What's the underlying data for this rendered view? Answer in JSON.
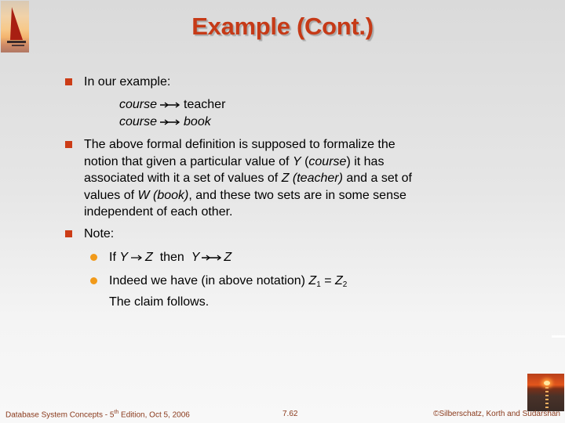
{
  "slide": {
    "title": "Example (Cont.)",
    "bullets": [
      {
        "text": "In our example:",
        "examples": [
          {
            "left": "course",
            "arrow": "multivalued-dependency-arrow",
            "right": "teacher",
            "right_italic": false
          },
          {
            "left": "course",
            "arrow": "multivalued-dependency-arrow",
            "right": "book",
            "right_italic": true
          }
        ]
      },
      {
        "lines": [
          {
            "parts": [
              "The above formal definition is supposed to formalize the"
            ]
          },
          {
            "parts": [
              "notion that given a particular value of ",
              "Y",
              " (",
              "course",
              ") it has"
            ]
          },
          {
            "parts": [
              "associated with it a set of values of ",
              "Z (teacher)",
              " and a set of"
            ]
          },
          {
            "parts": [
              "values of ",
              "W (book)",
              ", and these two sets are in some sense"
            ]
          },
          {
            "parts": [
              "independent of each other."
            ]
          }
        ]
      },
      {
        "text": "Note:",
        "sub_bullets": [
          {
            "if": "If",
            "y1": "Y",
            "z1": "Z",
            "then": "then",
            "y2": "Y",
            "z2": "Z"
          },
          {
            "line1": "Indeed we have (in above notation) ",
            "z": "Z",
            "sub1": "1",
            "eq": " = ",
            "sub2": "2",
            "line2": "The claim follows."
          }
        ]
      }
    ]
  },
  "footer": {
    "left_prefix": "Database System Concepts - 5",
    "left_sup": "th",
    "left_suffix": " Edition, Oct 5, 2006",
    "center": "7.62",
    "right": "©Silberschatz, Korth and Sudarshan"
  },
  "icons": {
    "logo": "sailboat-icon",
    "footer_image": "sunset-icon"
  },
  "colors": {
    "title": "#c63a17",
    "square_bullet": "#cc3c16",
    "round_bullet": "#f19a1a",
    "footer_text": "#8a3a1c"
  }
}
